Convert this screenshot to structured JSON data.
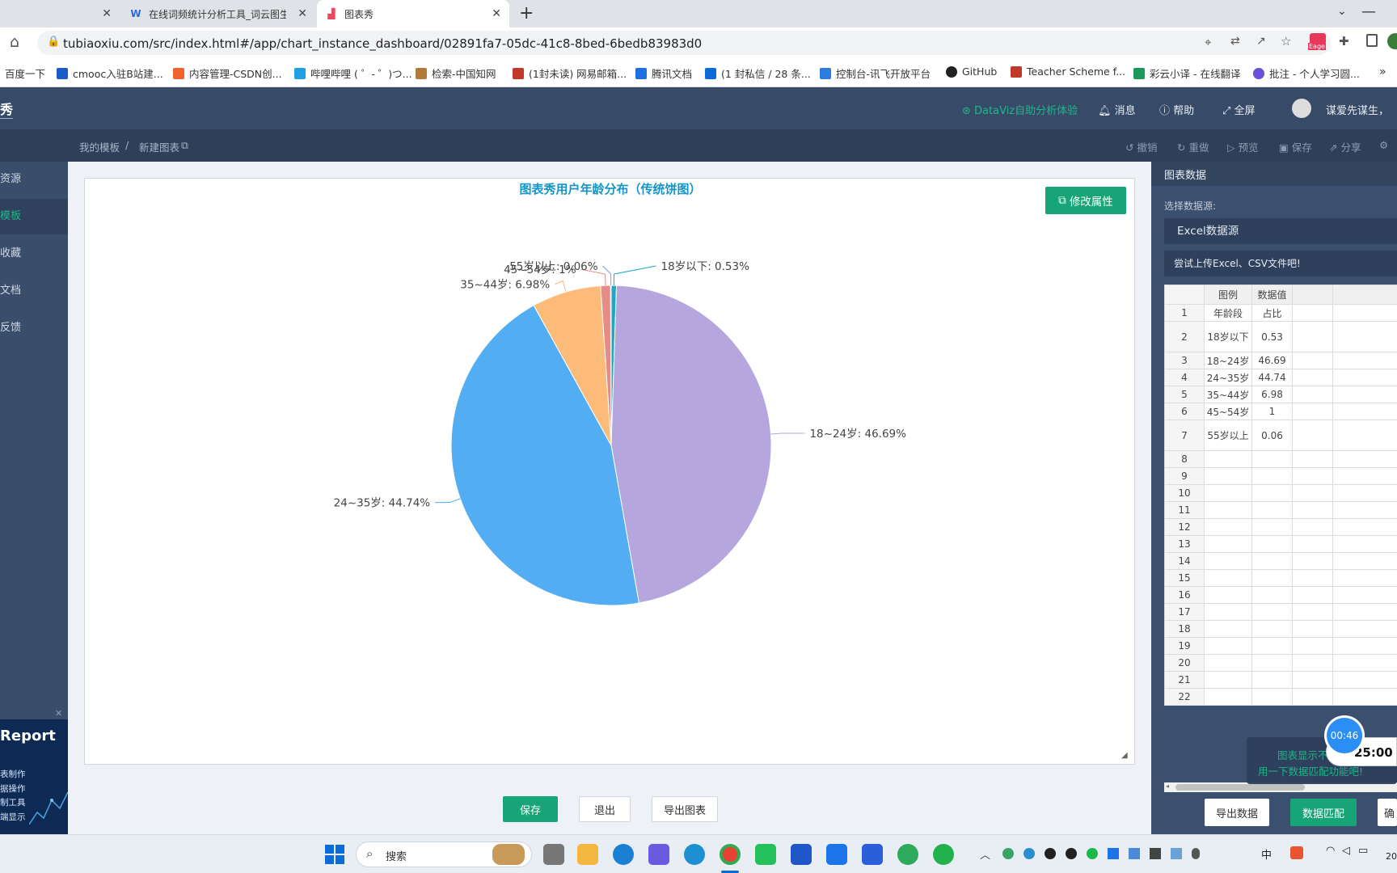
{
  "browser": {
    "tabs": [
      {
        "title": ""
      },
      {
        "title": "在线词频统计分析工具_词云图生"
      },
      {
        "title": "图表秀"
      }
    ],
    "url": "tubiaoxiu.com/src/index.html#/app/chart_instance_dashboard/02891fa7-05dc-41c8-8bed-6bedb83983d0",
    "bookmarks": [
      "百度一下",
      "cmooc入驻B站建...",
      "内容管理-CSDN创...",
      "哔哩哔哩 ( ゜- ゜)つ...",
      "检索-中国知网",
      "(1封未读) 网易邮箱...",
      "腾讯文档",
      "(1 封私信 / 28 条...",
      "控制台-讯飞开放平台",
      "GitHub",
      "Teacher Scheme f...",
      "彩云小译 - 在线翻译",
      "批注 - 个人学习圆..."
    ],
    "profile_badge": "Eage"
  },
  "header": {
    "logo": "秀",
    "dataviz": "DataViz自助分析体验",
    "messages": "消息",
    "help": "帮助",
    "fullscreen": "全屏",
    "user": "谋爱先谋生，"
  },
  "breadcrumb": {
    "home": "我的模板",
    "sep": "/",
    "current": "新建图表"
  },
  "toolbar": {
    "undo": "撤销",
    "redo": "重做",
    "preview": "预览",
    "save": "保存",
    "share": "分享"
  },
  "sidebar": {
    "items": [
      {
        "label": "资源"
      },
      {
        "label": "模板"
      },
      {
        "label": "收藏"
      },
      {
        "label": "文档"
      },
      {
        "label": "反馈"
      }
    ],
    "ad": {
      "title": "Report",
      "lines": [
        "表制作",
        "据操作",
        "制工具",
        "端显示"
      ]
    }
  },
  "chart": {
    "edit_button": "修改属性"
  },
  "chart_data": {
    "type": "pie",
    "title": "图表秀用户年龄分布（传统饼图）",
    "categories": [
      "18岁以下",
      "18~24岁",
      "24~35岁",
      "35~44岁",
      "45~54岁",
      "55岁以上"
    ],
    "values": [
      0.53,
      46.69,
      44.74,
      6.98,
      1,
      0.06
    ],
    "labels": [
      "18岁以下: 0.53%",
      "18~24岁: 46.69%",
      "24~35岁: 44.74%",
      "35~44岁: 6.98%",
      "45~54岁: 1%",
      "55岁以上: 0.06%"
    ],
    "colors": [
      "#1aa9c7",
      "#b5a6dd",
      "#52adf2",
      "#fdbb7a",
      "#e68b86",
      "#6aa8e8"
    ]
  },
  "bottom_buttons": {
    "save": "保存",
    "exit": "退出",
    "export": "导出图表"
  },
  "right_panel": {
    "title": "图表数据",
    "select_label": "选择数据源:",
    "source": "Excel数据源",
    "upload_hint": "尝试上传Excel、CSV文件吧!",
    "columns": [
      "图例",
      "数据值"
    ],
    "rows": [
      {
        "n": "1",
        "a": "年龄段",
        "b": "占比"
      },
      {
        "n": "2",
        "a": "18岁以下",
        "b": "0.53"
      },
      {
        "n": "3",
        "a": "18~24岁",
        "b": "46.69"
      },
      {
        "n": "4",
        "a": "24~35岁",
        "b": "44.74"
      },
      {
        "n": "5",
        "a": "35~44岁",
        "b": "6.98"
      },
      {
        "n": "6",
        "a": "45~54岁",
        "b": "1"
      },
      {
        "n": "7",
        "a": "55岁以上",
        "b": "0.06"
      },
      {
        "n": "8",
        "a": "",
        "b": ""
      },
      {
        "n": "9",
        "a": "",
        "b": ""
      },
      {
        "n": "10",
        "a": "",
        "b": ""
      },
      {
        "n": "11",
        "a": "",
        "b": ""
      },
      {
        "n": "12",
        "a": "",
        "b": ""
      },
      {
        "n": "13",
        "a": "",
        "b": ""
      },
      {
        "n": "14",
        "a": "",
        "b": ""
      },
      {
        "n": "15",
        "a": "",
        "b": ""
      },
      {
        "n": "16",
        "a": "",
        "b": ""
      },
      {
        "n": "17",
        "a": "",
        "b": ""
      },
      {
        "n": "18",
        "a": "",
        "b": ""
      },
      {
        "n": "19",
        "a": "",
        "b": ""
      },
      {
        "n": "20",
        "a": "",
        "b": ""
      },
      {
        "n": "21",
        "a": "",
        "b": ""
      },
      {
        "n": "22",
        "a": "",
        "b": ""
      }
    ],
    "export_data": "导出数据",
    "data_match": "数据匹配",
    "extra": "确",
    "tip_line1": "图表显示不",
    "tip_line2": "用一下数据匹配功能吧!",
    "timer_badge": "00:46",
    "timer": "25:00"
  },
  "taskbar": {
    "search": "搜索",
    "ime": "中",
    "clock": "20"
  }
}
